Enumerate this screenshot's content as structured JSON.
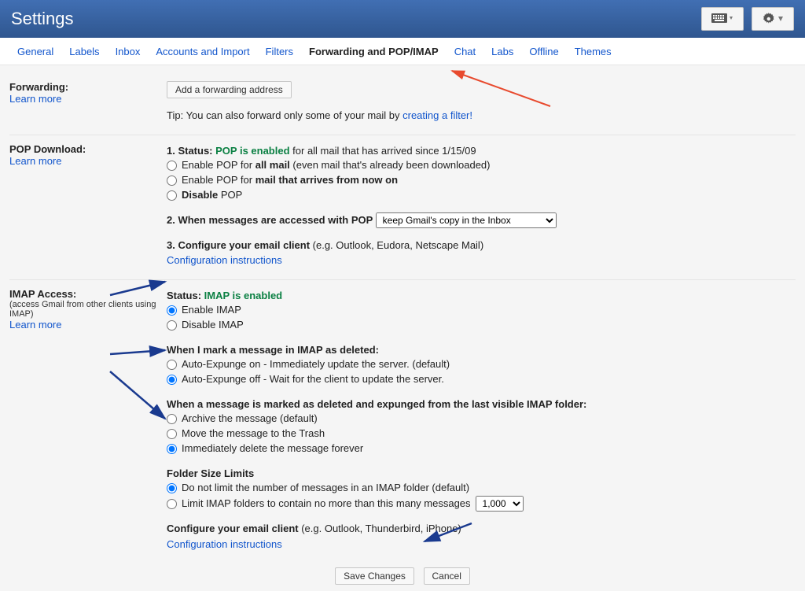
{
  "header": {
    "title": "Settings"
  },
  "tabs": {
    "items": [
      "General",
      "Labels",
      "Inbox",
      "Accounts and Import",
      "Filters",
      "Forwarding and POP/IMAP",
      "Chat",
      "Labs",
      "Offline",
      "Themes"
    ],
    "active_index": 5
  },
  "forwarding": {
    "label": "Forwarding:",
    "learn_more": "Learn more",
    "add_button": "Add a forwarding address",
    "tip_prefix": "Tip: You can also forward only some of your mail by ",
    "tip_link": "creating a filter!"
  },
  "pop": {
    "label": "POP Download:",
    "learn_more": "Learn more",
    "status_prefix": "1. Status: ",
    "status_value": "POP is enabled",
    "status_suffix": " for all mail that has arrived since 1/15/09",
    "opt_allmail_prefix": "Enable POP for ",
    "opt_allmail_bold": "all mail",
    "opt_allmail_suffix": " (even mail that's already been downloaded)",
    "opt_nowon_prefix": "Enable POP for ",
    "opt_nowon_bold": "mail that arrives from now on",
    "opt_disable_prefix": "Disable",
    "opt_disable_suffix": " POP",
    "accessed_label": "2. When messages are accessed with POP  ",
    "accessed_select": "keep Gmail's copy in the Inbox",
    "configure_bold": "3. Configure your email client",
    "configure_rest": " (e.g. Outlook, Eudora, Netscape Mail)",
    "config_link": "Configuration instructions"
  },
  "imap": {
    "label": "IMAP Access:",
    "sublabel": "(access Gmail from other clients using IMAP)",
    "learn_more": "Learn more",
    "status_prefix": "Status: ",
    "status_value": "IMAP is enabled",
    "opt_enable": "Enable IMAP",
    "opt_disable": "Disable IMAP",
    "deleted_heading": "When I mark a message in IMAP as deleted:",
    "auto_on": "Auto-Expunge on - Immediately update the server. (default)",
    "auto_off": "Auto-Expunge off - Wait for the client to update the server.",
    "expunged_heading": "When a message is marked as deleted and expunged from the last visible IMAP folder:",
    "exp_archive": "Archive the message (default)",
    "exp_trash": "Move the message to the Trash",
    "exp_delete": "Immediately delete the message forever",
    "folder_heading": "Folder Size Limits",
    "folder_nolimit": "Do not limit the number of messages in an IMAP folder (default)",
    "folder_limit": "Limit IMAP folders to contain no more than this many messages ",
    "folder_limit_select": "1,000",
    "configure_bold": "Configure your email client",
    "configure_rest": " (e.g. Outlook, Thunderbird, iPhone)",
    "config_link": "Configuration instructions"
  },
  "footer": {
    "save": "Save Changes",
    "cancel": "Cancel"
  }
}
